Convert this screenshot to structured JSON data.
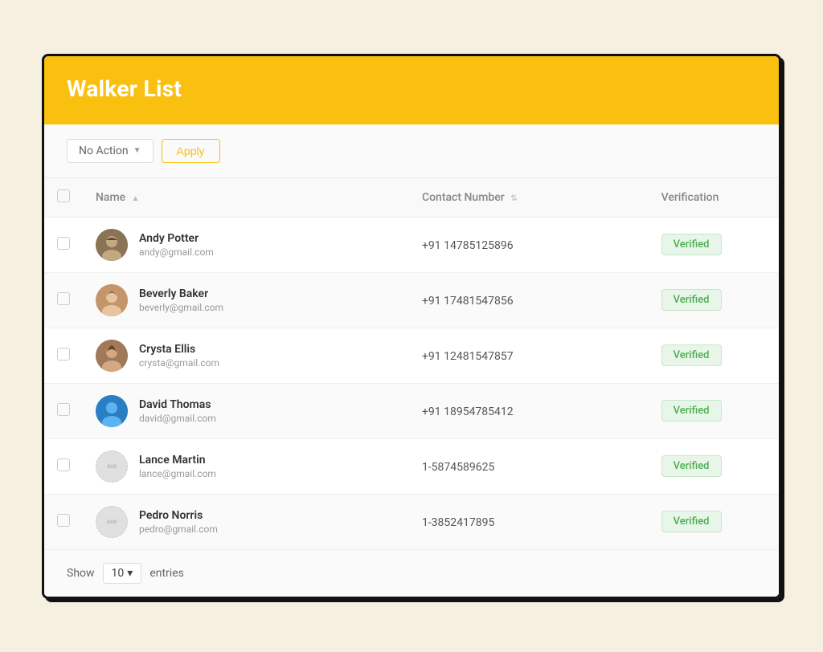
{
  "header": {
    "title": "Walker List"
  },
  "toolbar": {
    "action_label": "No Action",
    "apply_label": "Apply"
  },
  "table": {
    "columns": [
      {
        "key": "check",
        "label": ""
      },
      {
        "key": "name",
        "label": "Name",
        "sortable": true
      },
      {
        "key": "contact",
        "label": "Contact Number",
        "sortable": true
      },
      {
        "key": "verification",
        "label": "Verification"
      }
    ],
    "rows": [
      {
        "id": 1,
        "name": "Andy Potter",
        "email": "andy@gmail.com",
        "contact": "+91 14785125896",
        "verification": "Verified",
        "avatar_type": "brown"
      },
      {
        "id": 2,
        "name": "Beverly Baker",
        "email": "beverly@gmail.com",
        "contact": "+91 17481547856",
        "verification": "Verified",
        "avatar_type": "tan"
      },
      {
        "id": 3,
        "name": "Crysta Ellis",
        "email": "crysta@gmail.com",
        "contact": "+91 12481547857",
        "verification": "Verified",
        "avatar_type": "beige"
      },
      {
        "id": 4,
        "name": "David Thomas",
        "email": "david@gmail.com",
        "contact": "+91 18954785412",
        "verification": "Verified",
        "avatar_type": "blue"
      },
      {
        "id": 5,
        "name": "Lance Martin",
        "email": "lance@gmail.com",
        "contact": "1-5874589625",
        "verification": "Verified",
        "avatar_type": "placeholder"
      },
      {
        "id": 6,
        "name": "Pedro Norris",
        "email": "pedro@gmail.com",
        "contact": "1-3852417895",
        "verification": "Verified",
        "avatar_type": "placeholder"
      }
    ]
  },
  "footer": {
    "show_label": "Show",
    "entries_count": "10",
    "entries_label": "entries"
  },
  "colors": {
    "header_bg": "#F9C00F",
    "verified_color": "#4caf50",
    "verified_bg": "#e8f5e9"
  }
}
